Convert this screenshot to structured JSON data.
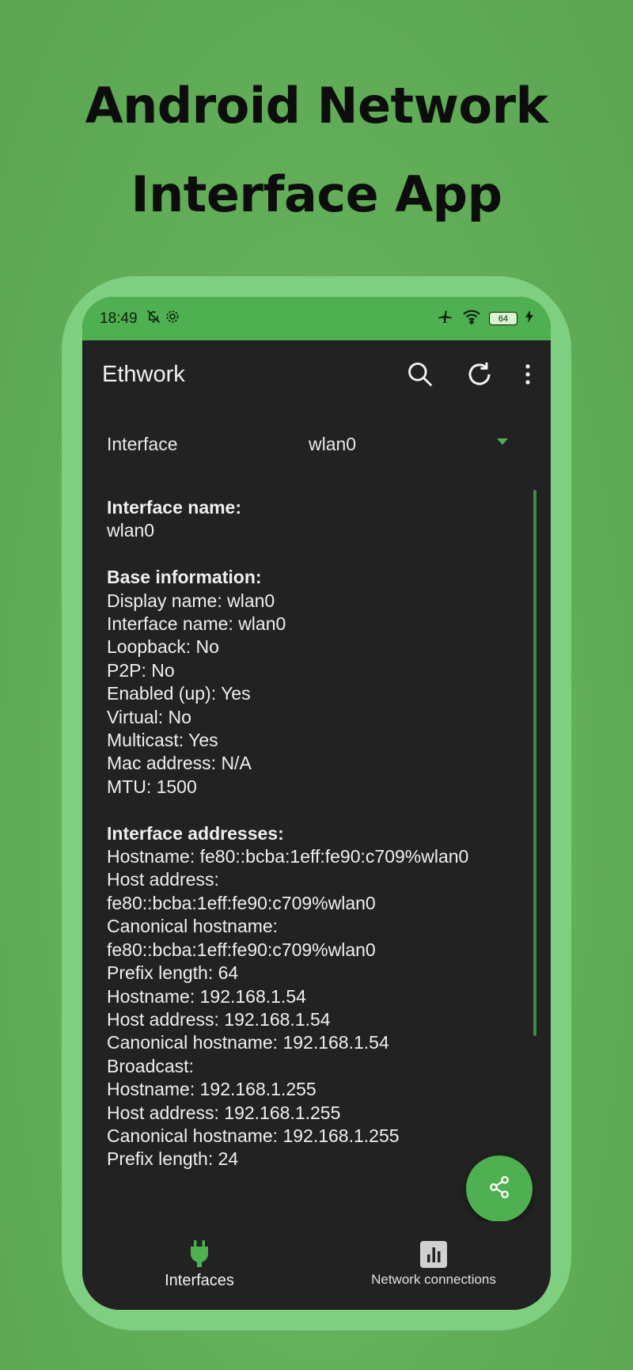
{
  "headline": {
    "line1": "Android Network",
    "line2": "Interface App"
  },
  "statusbar": {
    "time": "18:49",
    "battery": "64",
    "icons": [
      "bell-off-icon",
      "settings-gear-icon",
      "airplane-icon",
      "wifi-icon",
      "battery-icon",
      "charging-bolt-icon"
    ]
  },
  "appbar": {
    "title": "Ethwork",
    "actions": [
      "search-icon",
      "refresh-icon",
      "more-vert-icon"
    ]
  },
  "selector": {
    "label": "Interface",
    "value": "wlan0"
  },
  "details": {
    "interface_name_head": "Interface name:",
    "interface_name": "wlan0",
    "base_head": "Base information:",
    "base_lines": [
      "Display name: wlan0",
      "Interface name: wlan0",
      "Loopback: No",
      "P2P: No",
      "Enabled (up): Yes",
      "Virtual: No",
      "Multicast: Yes",
      "Mac address: N/A",
      "MTU: 1500"
    ],
    "addresses_head": "Interface addresses:",
    "address_lines": [
      "Hostname: fe80::bcba:1eff:fe90:c709%wlan0",
      "Host address:",
      "fe80::bcba:1eff:fe90:c709%wlan0",
      "Canonical hostname:",
      "fe80::bcba:1eff:fe90:c709%wlan0",
      "Prefix length: 64",
      "Hostname: 192.168.1.54",
      "Host address: 192.168.1.54",
      "Canonical hostname: 192.168.1.54",
      "Broadcast:",
      "Hostname: 192.168.1.255",
      "Host address: 192.168.1.255",
      "Canonical hostname: 192.168.1.255",
      "Prefix length: 24"
    ]
  },
  "fab": {
    "icon": "share-icon"
  },
  "bottomnav": {
    "items": [
      {
        "label": "Interfaces",
        "icon": "plug-icon",
        "active": true
      },
      {
        "label": "Network connections",
        "icon": "bar-chart-icon",
        "active": false
      }
    ]
  },
  "colors": {
    "background": "#62ae58",
    "frame": "#7ecf80",
    "accent": "#4eb050",
    "screen": "#222222"
  }
}
